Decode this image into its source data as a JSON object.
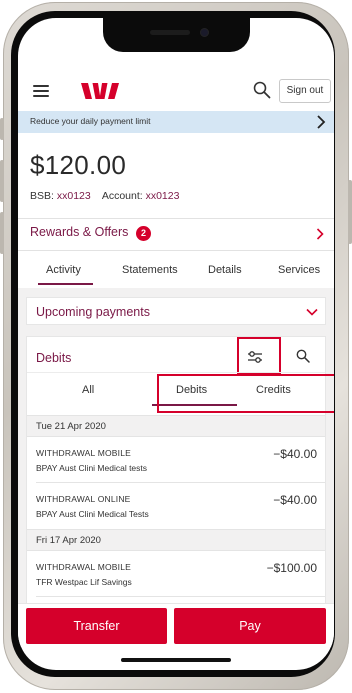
{
  "header": {
    "signout_label": "Sign out"
  },
  "banner": {
    "text": "Reduce your daily payment limit"
  },
  "account": {
    "balance": "$120.00",
    "bsb_label": "BSB:",
    "bsb_value": "xx0123",
    "account_label": "Account:",
    "account_value": "xx0123"
  },
  "rewards": {
    "label": "Rewards & Offers",
    "badge_count": "2"
  },
  "tabs": [
    {
      "label": "Activity"
    },
    {
      "label": "Statements"
    },
    {
      "label": "Details"
    },
    {
      "label": "Services"
    }
  ],
  "upcoming": {
    "label": "Upcoming payments"
  },
  "debits": {
    "title": "Debits",
    "filters": [
      {
        "label": "All"
      },
      {
        "label": "Debits"
      },
      {
        "label": "Credits"
      }
    ]
  },
  "groups": [
    {
      "date": "Tue 21 Apr 2020",
      "transactions": [
        {
          "title": "WITHDRAWAL MOBILE",
          "subtitle": "BPAY Aust Clini Medical tests",
          "amount": "−$40.00"
        },
        {
          "title": "WITHDRAWAL ONLINE",
          "subtitle": "BPAY Aust Clini Medical Tests",
          "amount": "−$40.00"
        }
      ]
    },
    {
      "date": "Fri 17 Apr 2020",
      "transactions": [
        {
          "title": "WITHDRAWAL MOBILE",
          "subtitle": "TFR Westpac Lif Savings",
          "amount": "−$100.00"
        }
      ]
    }
  ],
  "actions": {
    "transfer_label": "Transfer",
    "pay_label": "Pay"
  },
  "colors": {
    "brand_red": "#d5002b",
    "brand_maroon": "#7a1846",
    "banner_blue": "#d5e6f4"
  },
  "icons": [
    "hamburger-menu-icon",
    "westpac-logo-icon",
    "search-icon",
    "chevron-right-icon",
    "chevron-down-icon",
    "filter-sliders-icon"
  ]
}
